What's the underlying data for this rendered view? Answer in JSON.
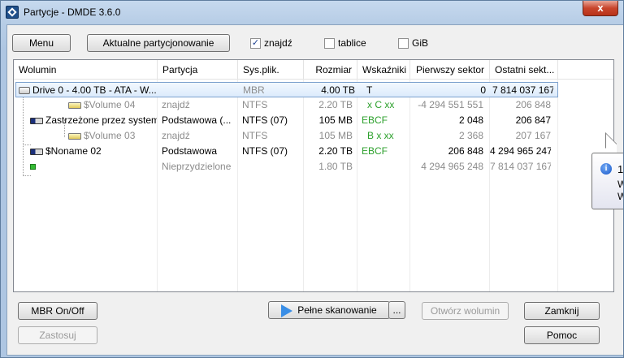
{
  "window": {
    "title": "Partycje - DMDE 3.6.0",
    "close_glyph": "x"
  },
  "toolbar": {
    "menu_label": "Menu",
    "current_partitioning_label": "Aktualne partycjonowanie",
    "checkboxes": [
      {
        "label": "znajdź",
        "checked": true,
        "check_glyph": "✓"
      },
      {
        "label": "tablice",
        "checked": false,
        "check_glyph": ""
      },
      {
        "label": "GiB",
        "checked": false,
        "check_glyph": ""
      }
    ]
  },
  "table": {
    "columns": [
      "Wolumin",
      "Partycja",
      "Sys.plik.",
      "Rozmiar",
      "Wskaźniki",
      "Pierwszy sektor",
      "Ostatni sekt..."
    ],
    "rows": [
      {
        "volume": "Drive 0 - 4.00 TB - ATA - W...",
        "partition": "",
        "fs": "MBR",
        "size": "4.00 TB",
        "flags": "T",
        "first": "0",
        "last": "7 814 037 167",
        "icon": "drive-icon",
        "selected": true
      },
      {
        "volume": "$Volume 04",
        "partition": "znajdź",
        "fs": "NTFS",
        "size": "2.20 TB",
        "flags": "x C xx",
        "first": "-4 294 551 551",
        "last": "206 848",
        "icon": "volume-icon",
        "dim": true
      },
      {
        "volume": "Zastrzeżone przez system",
        "partition": "Podstawowa (...",
        "fs": "NTFS (07)",
        "size": "105 MB",
        "flags": "EBCF",
        "first": "2 048",
        "last": "206 847",
        "icon": "system-volume-icon"
      },
      {
        "volume": "$Volume 03",
        "partition": "znajdź",
        "fs": "NTFS",
        "size": "105 MB",
        "flags": "B x xx",
        "first": "2 368",
        "last": "207 167",
        "icon": "volume-icon",
        "dim": true
      },
      {
        "volume": "$Noname 02",
        "partition": "Podstawowa",
        "fs": "NTFS (07)",
        "size": "2.20 TB",
        "flags": "EBCF",
        "first": "206 848",
        "last": "4 294 965 247",
        "icon": "system-volume-icon"
      },
      {
        "volume": "",
        "partition": "Nieprzydzielone",
        "fs": "",
        "size": "1.80 TB",
        "flags": "",
        "first": "4 294 965 248",
        "last": "7 814 037 167",
        "icon": "unallocated-icon",
        "dim": true
      }
    ]
  },
  "buttons": {
    "mbr_onoff": "MBR On/Off",
    "apply": "Zastosuj",
    "full_scan": "Pełne skanowanie",
    "more": "...",
    "open_volume": "Otwórz wolumin",
    "close": "Zamknij",
    "help": "Pomoc"
  },
  "tooltip": {
    "line1": "1",
    "line2": "W",
    "line3": "W"
  },
  "colors": {
    "selection": "#dcebfc",
    "flag_green": "#2ca02c",
    "dim_text": "#8c8c8c"
  }
}
